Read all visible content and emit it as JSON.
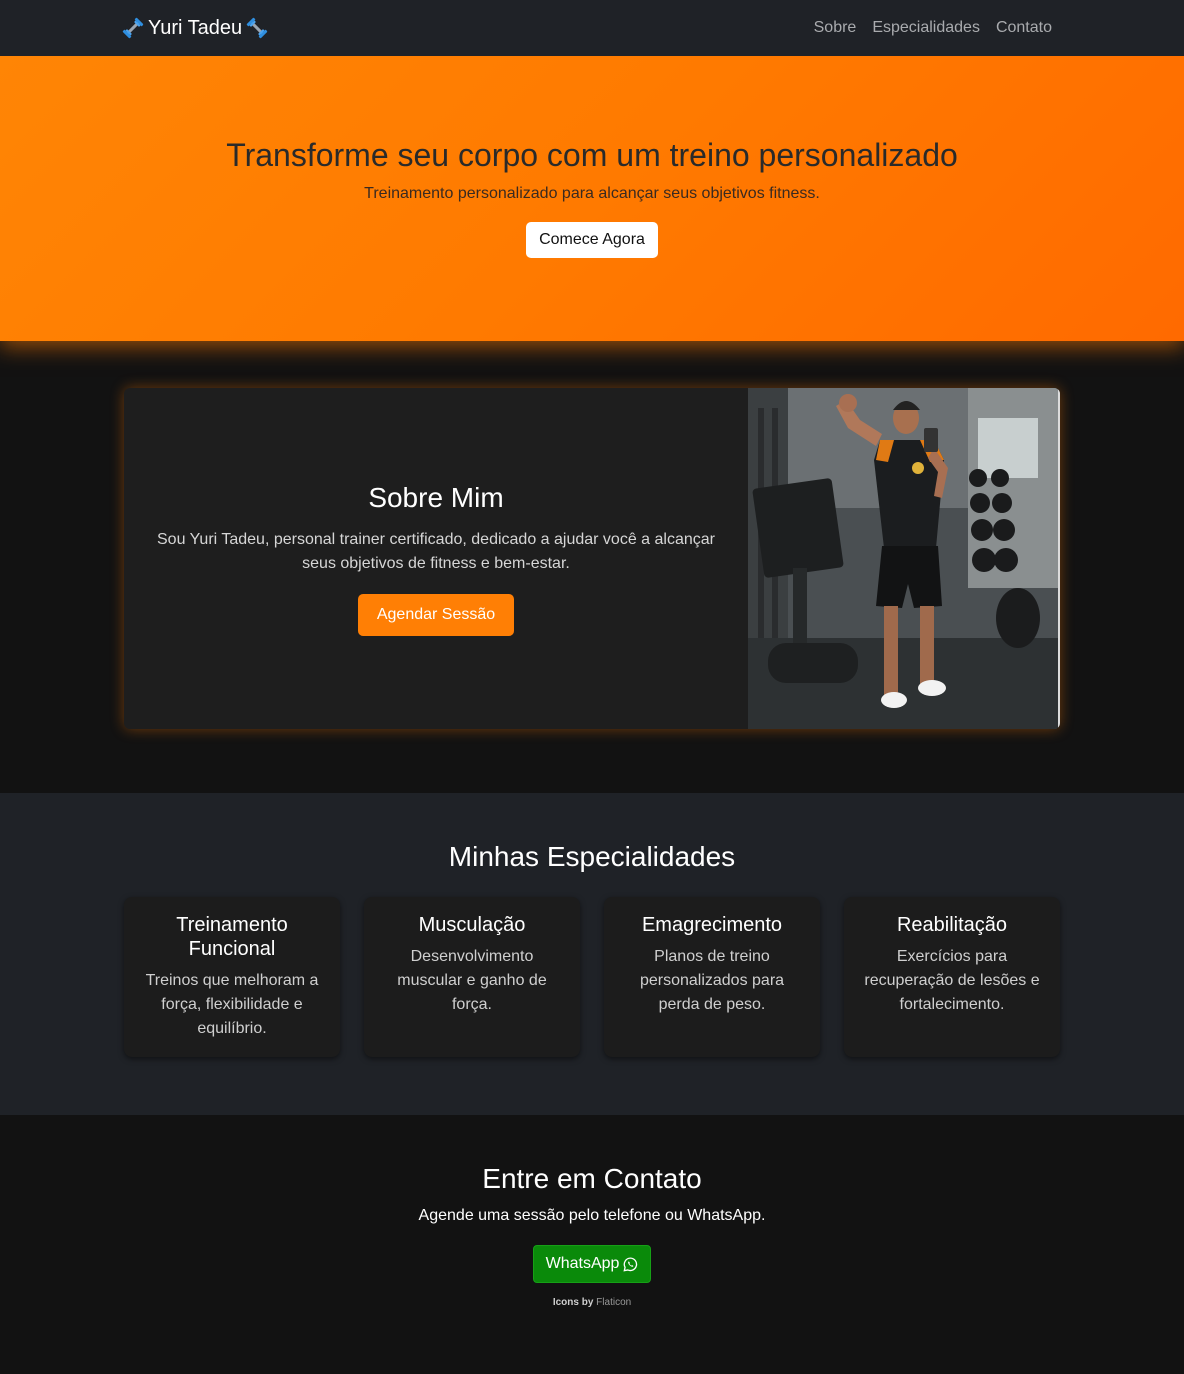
{
  "navbar": {
    "brand": "Yuri Tadeu",
    "links": [
      "Sobre",
      "Especialidades",
      "Contato"
    ]
  },
  "hero": {
    "title": "Transforme seu corpo com um treino personalizado",
    "subtitle": "Treinamento personalizado para alcançar seus objetivos fitness.",
    "cta": "Comece Agora"
  },
  "about": {
    "title": "Sobre Mim",
    "description": "Sou Yuri Tadeu, personal trainer certificado, dedicado a ajudar você a alcançar seus objetivos de fitness e bem-estar.",
    "cta": "Agendar Sessão"
  },
  "specialties": {
    "title": "Minhas Especialidades",
    "items": [
      {
        "title": "Treinamento Funcional",
        "description": "Treinos que melhoram a força, flexibilidade e equilíbrio."
      },
      {
        "title": "Musculação",
        "description": "Desenvolvimento muscular e ganho de força."
      },
      {
        "title": "Emagrecimento",
        "description": "Planos de treino personalizados para perda de peso."
      },
      {
        "title": "Reabilitação",
        "description": "Exercícios para recuperação de lesões e fortalecimento."
      }
    ]
  },
  "contact": {
    "title": "Entre em Contato",
    "subtitle": "Agende uma sessão pelo telefone ou WhatsApp.",
    "whatsapp_label": "WhatsApp",
    "credits_prefix": "Icons by",
    "credits_link": "Flaticon"
  },
  "colors": {
    "accent": "#ff7f05",
    "navbar": "#1f2227",
    "whatsapp": "#0a8a0a"
  },
  "icons": [
    "dumbbell-icon",
    "whatsapp-icon"
  ]
}
